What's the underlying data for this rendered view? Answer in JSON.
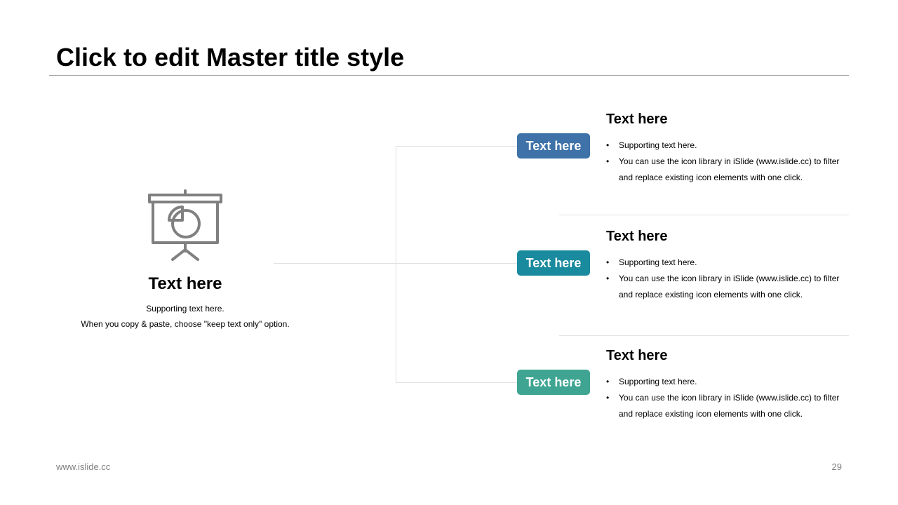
{
  "slide": {
    "title": "Click to edit Master title style",
    "footer": {
      "website": "www.islide.cc",
      "page_number": "29"
    }
  },
  "center": {
    "icon": "presentation-board-pie-chart-icon",
    "heading": "Text here",
    "lines": [
      "Supporting text here.",
      "When you copy & paste, choose \"keep text only\" option."
    ]
  },
  "items": [
    {
      "pill_label": "Text here",
      "pill_color": "#3E72A8",
      "heading": "Text here",
      "bullets": [
        "Supporting text here.",
        "You can use the icon library in iSlide  (www.islide.cc) to filter and replace existing icon elements with one click."
      ]
    },
    {
      "pill_label": "Text here",
      "pill_color": "#1A8A9E",
      "heading": "Text here",
      "bullets": [
        "Supporting text here.",
        "You can use the icon library in iSlide  (www.islide.cc) to filter and replace existing icon elements with one click."
      ]
    },
    {
      "pill_label": "Text here",
      "pill_color": "#3FA592",
      "heading": "Text here",
      "bullets": [
        "Supporting text here.",
        "You can use the icon library in iSlide  (www.islide.cc) to filter and replace existing icon elements with one click."
      ]
    }
  ]
}
